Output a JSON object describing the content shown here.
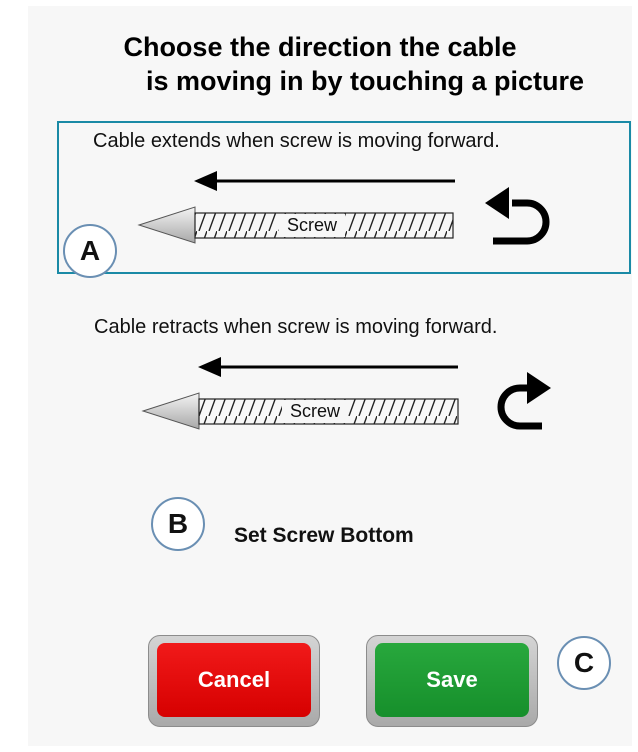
{
  "header": {
    "title_line1": "Choose the direction the cable",
    "title_line2": "is moving in by touching a picture"
  },
  "options": [
    {
      "caption": "Cable extends when screw is moving forward.",
      "screw_label": "Screw",
      "selected": true
    },
    {
      "caption": "Cable retracts when screw is moving forward.",
      "screw_label": "Screw",
      "selected": false
    }
  ],
  "set_screw_label": "Set Screw Bottom",
  "buttons": {
    "cancel": "Cancel",
    "save": "Save"
  },
  "callouts": {
    "a": "A",
    "b": "B",
    "c": "C"
  },
  "colors": {
    "selection_border": "#1a8aa6",
    "cancel": "#e80c0c",
    "save": "#1f9a33",
    "callout_border": "#6a8fb3"
  },
  "icons": {
    "option1_arrow": "counterclockwise-return-arrow-icon",
    "option2_arrow": "clockwise-return-arrow-icon",
    "direction": "left-arrow-icon"
  }
}
